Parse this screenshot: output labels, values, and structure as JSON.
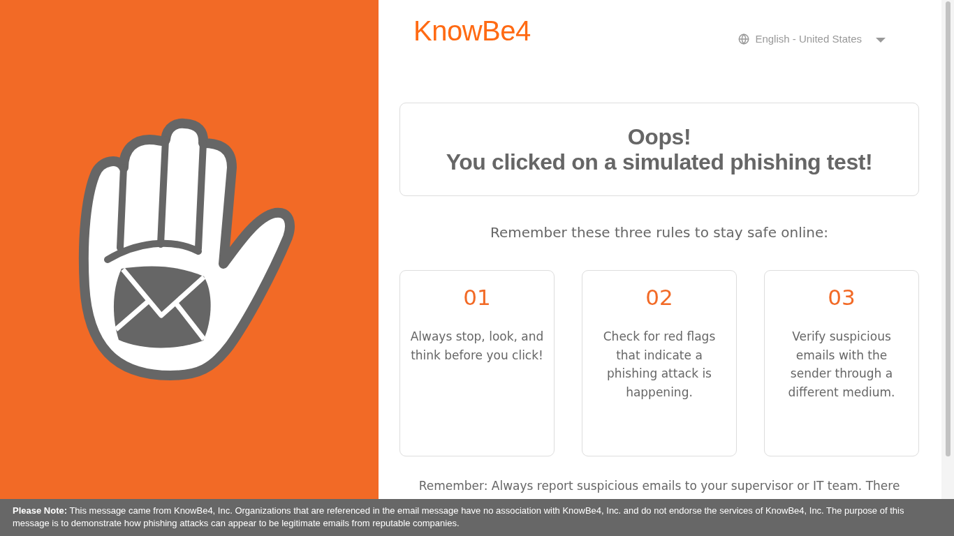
{
  "header": {
    "logo": "KnowBe4",
    "language": {
      "label": "English - United States"
    }
  },
  "hero": {
    "title_lines": [
      "Oops!",
      "You clicked on a simulated phishing test!"
    ]
  },
  "rules_intro": "Remember these three rules to stay safe online:",
  "rules": [
    {
      "number": "01",
      "text": "Always stop, look, and think before you click!"
    },
    {
      "number": "02",
      "text": "Check for red flags that indicate a phishing attack is happening."
    },
    {
      "number": "03",
      "text": "Verify suspicious emails with the sender through a different medium."
    }
  ],
  "reminder": "Remember: Always report suspicious emails to your supervisor or IT team. There",
  "footer": {
    "note": "**Please Note:** This message came from KnowBe4, Inc. Organizations that are referenced in the email message have no association with KnowBe4, Inc. and do not endorse the services of KnowBe4, Inc. The purpose of this message is to demonstrate how phishing attacks can appear to be legitimate emails from reputable companies."
  }
}
